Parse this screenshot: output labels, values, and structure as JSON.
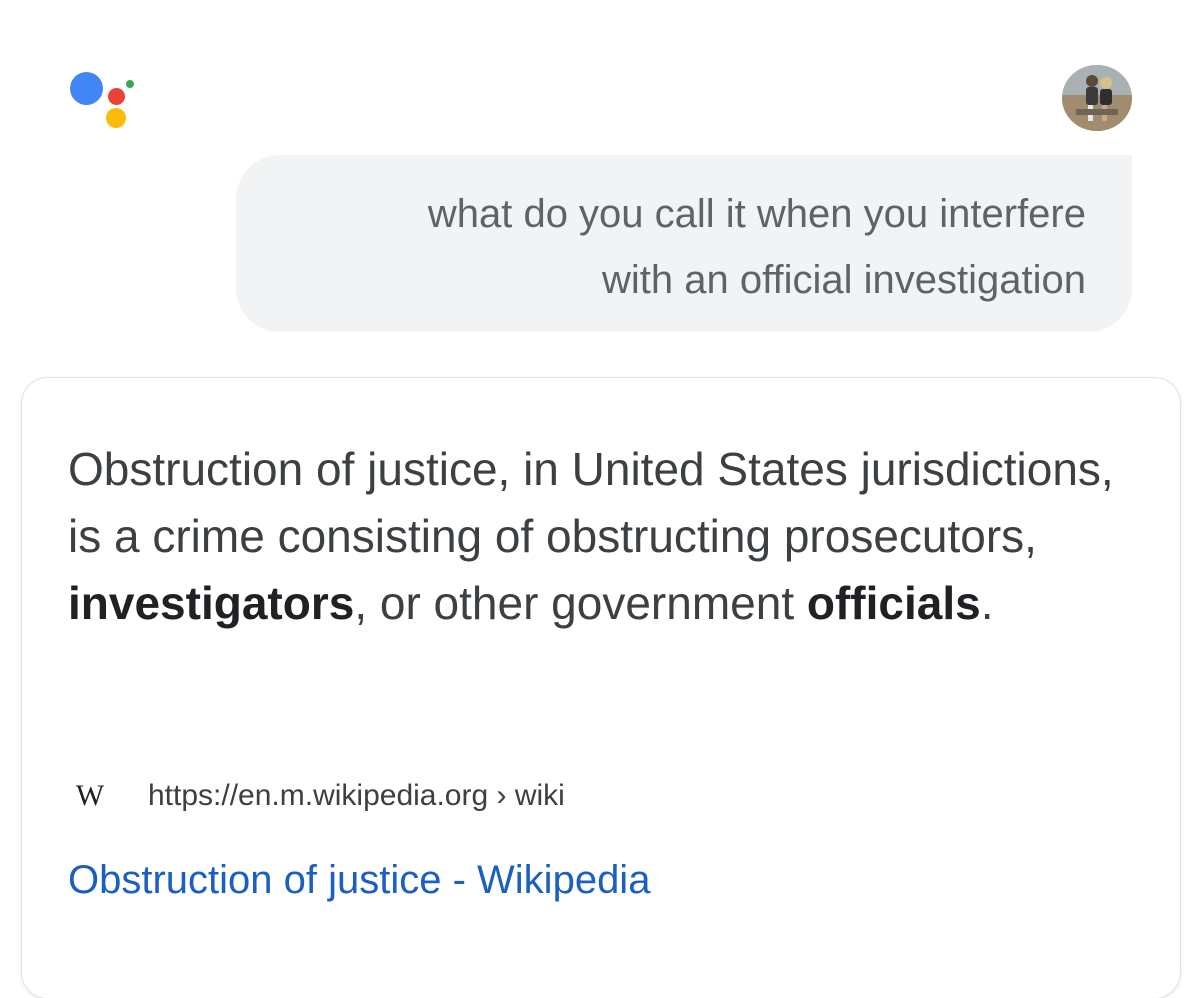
{
  "assistant": {
    "logo_icon": "google-assistant-icon"
  },
  "user": {
    "avatar_icon": "user-avatar"
  },
  "query": {
    "line1": "what do you call it when you interfere",
    "line2": "with an official investigation"
  },
  "answer": {
    "snippet": {
      "part1": "Obstruction of justice, in United States jurisdictions, is a crime consisting of obstructing prosecutors, ",
      "bold1": "investigators",
      "part2": ", or other government ",
      "bold2": "officials",
      "part3": "."
    },
    "source": {
      "favicon_letter": "W",
      "url": "https://en.m.wikipedia.org › wiki"
    },
    "result_title": "Obstruction of justice - Wikipedia"
  },
  "colors": {
    "assistant_blue": "#4285f4",
    "assistant_red": "#ea4335",
    "assistant_yellow": "#fbbc05",
    "assistant_green": "#34a853",
    "bubble_bg": "#f1f3f4",
    "link": "#1a5fc1"
  }
}
